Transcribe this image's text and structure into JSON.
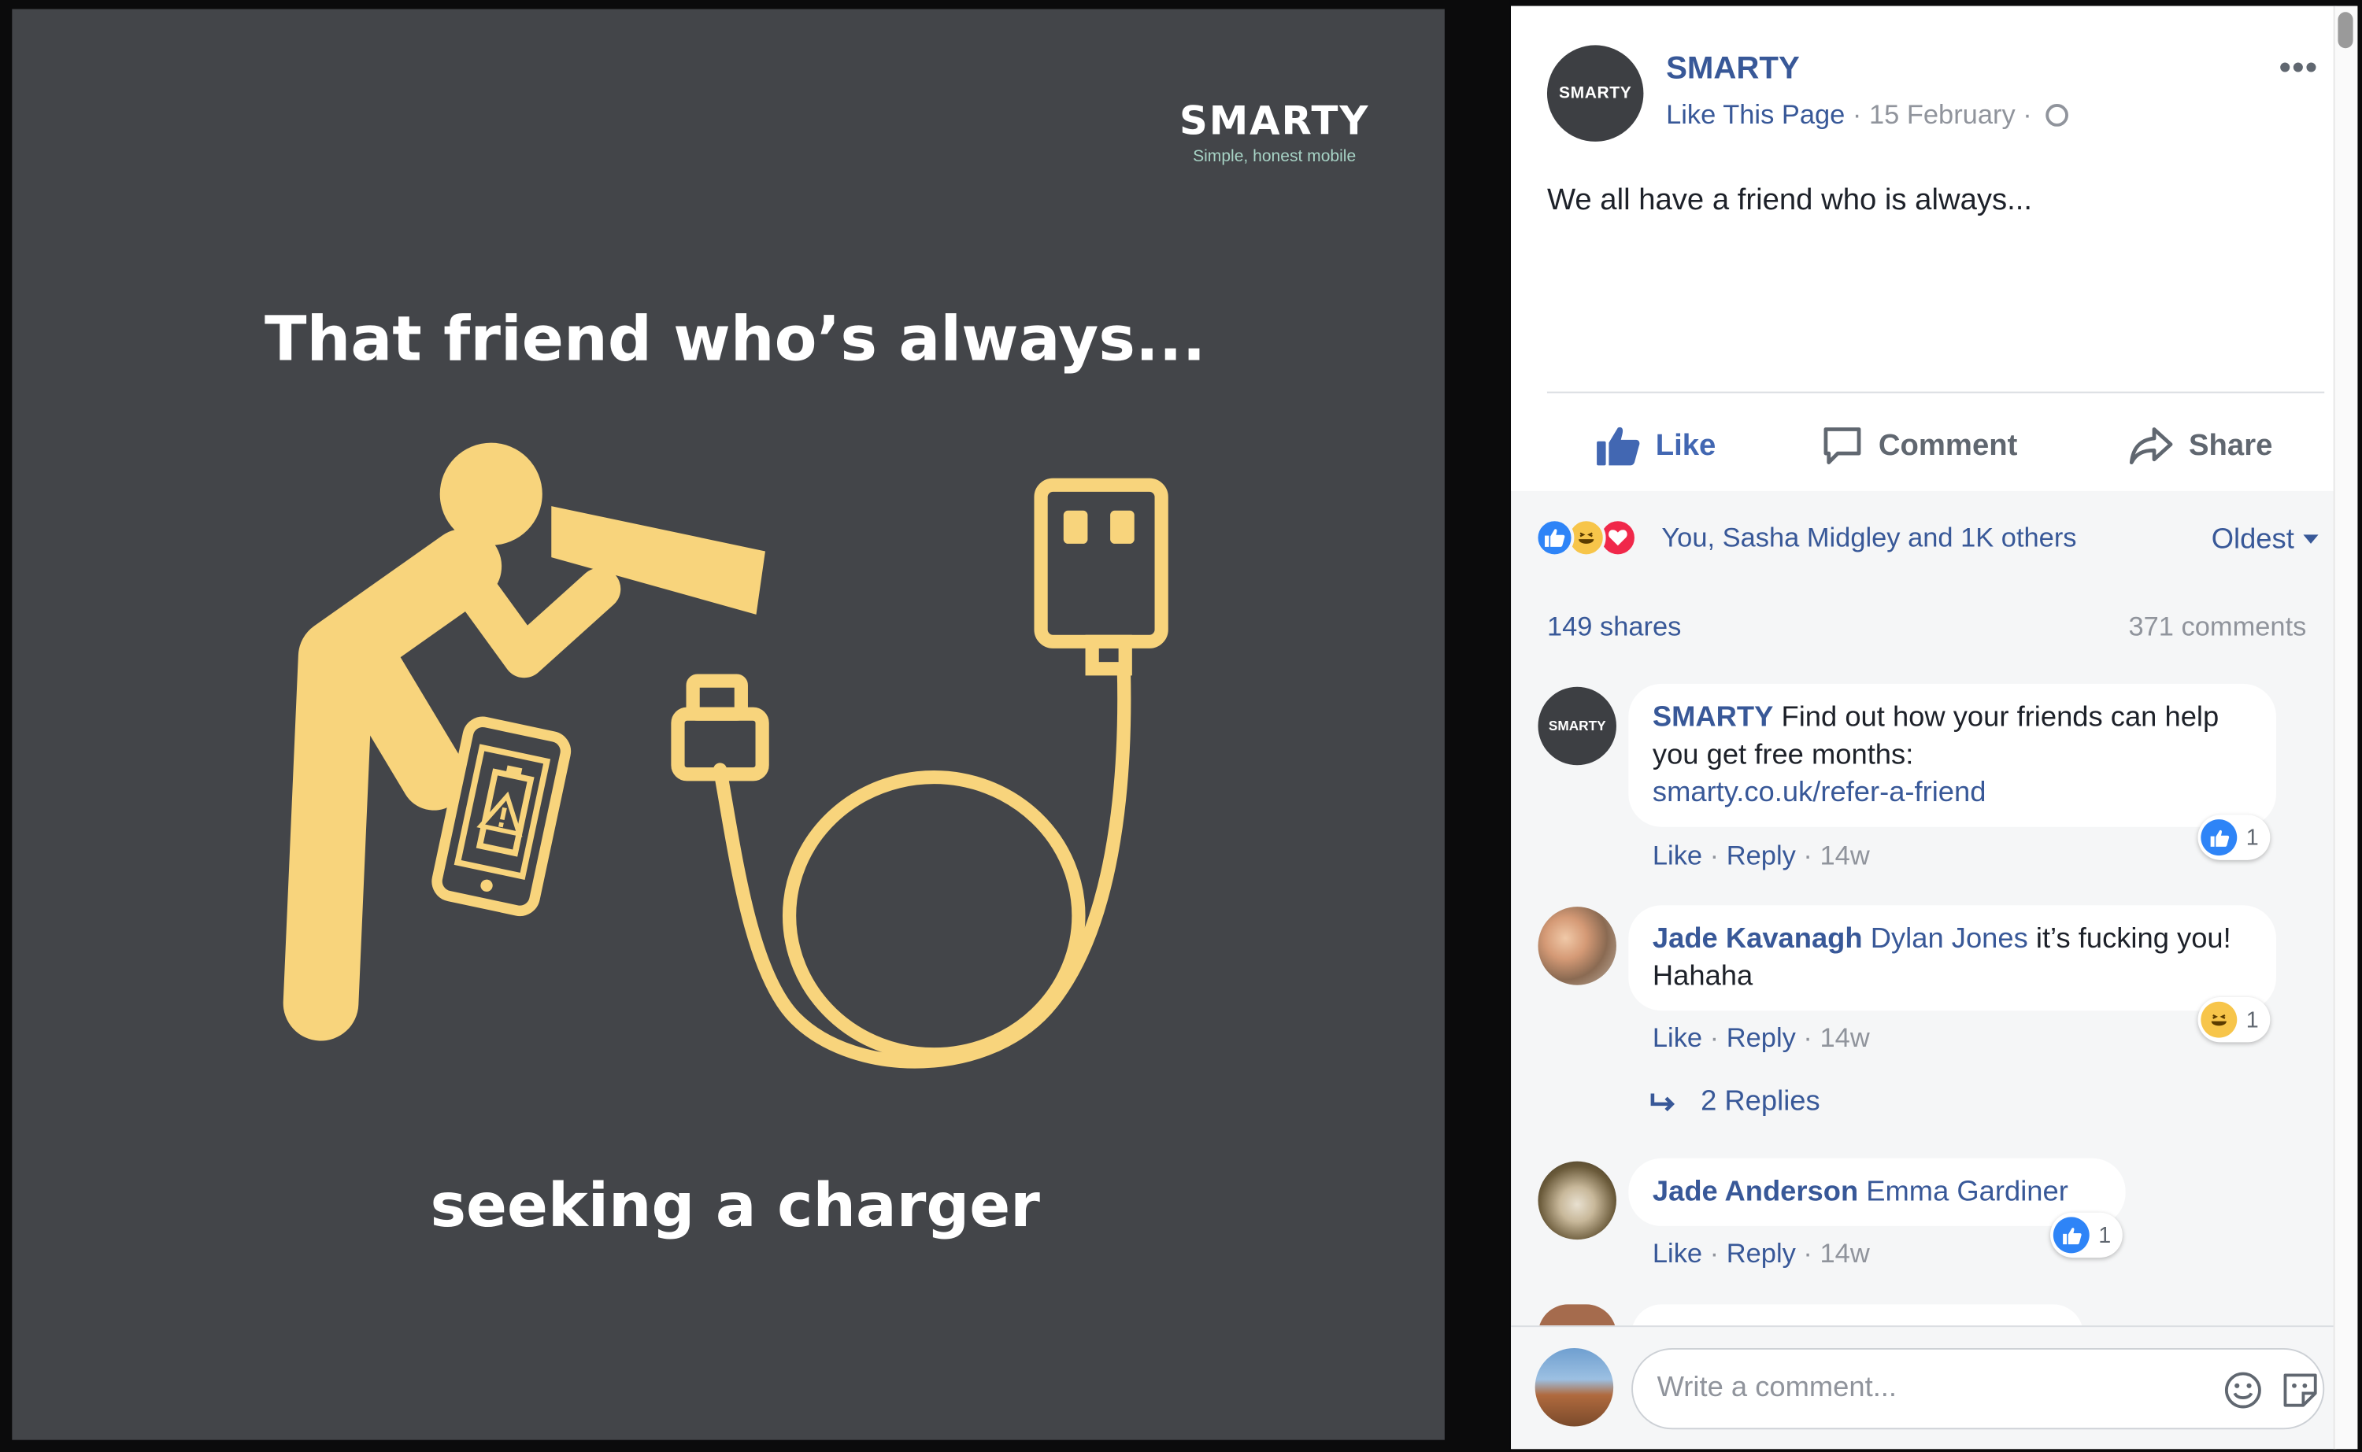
{
  "image": {
    "brand_name": "SMARTY",
    "brand_tagline": "Simple, honest mobile",
    "headline": "That friend who’s always...",
    "caption": "seeking a charger"
  },
  "post": {
    "page_name": "SMARTY",
    "avatar_text": "SMARTY",
    "like_page": "Like This Page",
    "date": "15 February",
    "sep": "·",
    "text": "We all have a friend who is always..."
  },
  "actions": {
    "like": "Like",
    "comment": "Comment",
    "share": "Share"
  },
  "stats": {
    "reactions_text": "You, Sasha Midgley and 1K others",
    "sort": "Oldest",
    "shares": "149 shares",
    "comments": "371 comments"
  },
  "comments": [
    {
      "avatar_text": "SMARTY",
      "author": "SMARTY",
      "text": "Find out how your friends can help you get free months:",
      "link": "smarty.co.uk/refer-a-friend",
      "like": "Like",
      "reply": "Reply",
      "time": "14w",
      "reaction_count": "1",
      "reaction_icon": "like-icon"
    },
    {
      "author": "Jade Kavanagh",
      "mention": "Dylan Jones",
      "text": "it’s fucking you! Hahaha",
      "like": "Like",
      "reply": "Reply",
      "time": "14w",
      "reaction_count": "1",
      "reaction_icon": "haha-icon",
      "replies": "2 Replies"
    },
    {
      "author": "Jade Anderson",
      "mention": "Emma Gardiner",
      "like": "Like",
      "reply": "Reply",
      "time": "14w",
      "reaction_count": "1",
      "reaction_icon": "like-icon"
    }
  ],
  "composer": {
    "placeholder": "Write a comment..."
  },
  "colors": {
    "photo_bg": "#434549",
    "illustration": "#f8d47c",
    "link_blue": "#385898",
    "like_blue": "#4267b2"
  }
}
